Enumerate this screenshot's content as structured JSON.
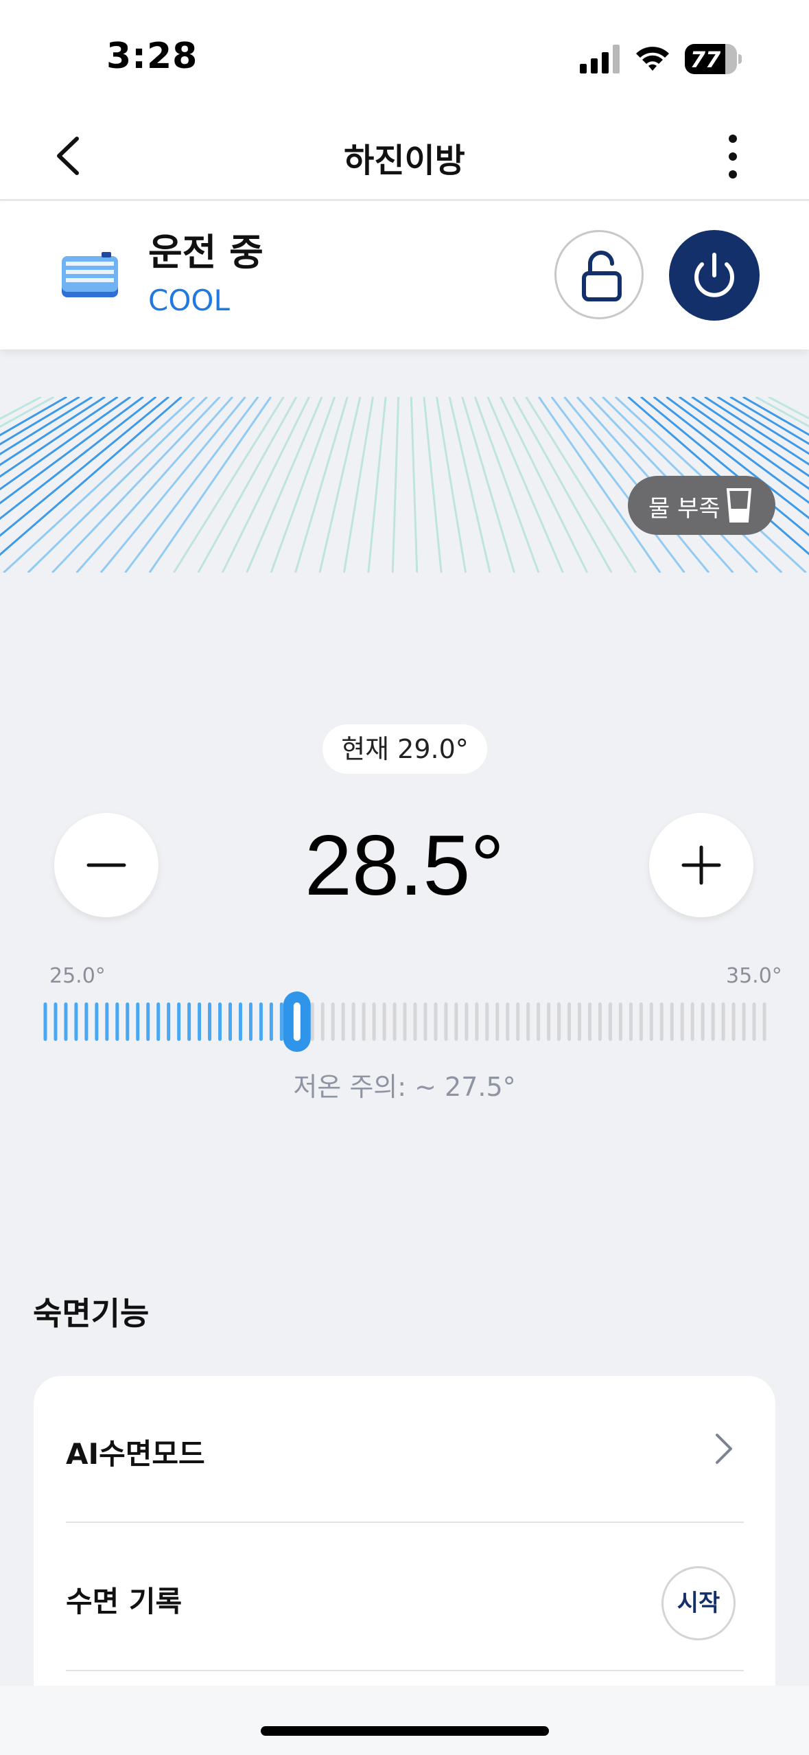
{
  "status_bar": {
    "time": "3:28",
    "battery": "77",
    "battery_level": 0.77
  },
  "header": {
    "title": "하진이방",
    "back_icon": "chevron-left-icon",
    "more_icon": "more-vertical-icon"
  },
  "device": {
    "run_status": "운전 중",
    "mode": "COOL",
    "lock_icon": "unlock-icon",
    "power_icon": "power-icon",
    "accent_color": "#14306b",
    "mode_color": "#1f79e0"
  },
  "water_badge": {
    "label": "물 부족",
    "icon": "water-cup-icon"
  },
  "temperature": {
    "current_label": "현재 29.0°",
    "set_temp": "28.5°",
    "set_value": 28.5,
    "range_min": "25.0°",
    "range_max": "35.0°",
    "min_value": 25.0,
    "max_value": 35.0,
    "warning": "저온 주의: ~ 27.5°",
    "active_color": "#4aa8f2",
    "inactive_color": "#d6d6d8"
  },
  "sleep": {
    "section_title": "숙면기능",
    "ai_mode_label": "AI수면모드",
    "record_label": "수면 기록",
    "start_label": "시작"
  }
}
